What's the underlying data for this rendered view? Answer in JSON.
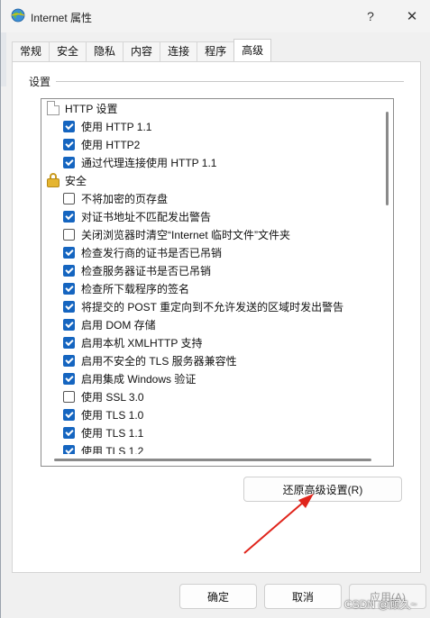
{
  "window": {
    "title": "Internet 属性",
    "help_label": "?",
    "close_label": "✕"
  },
  "tabs": [
    {
      "label": "常规"
    },
    {
      "label": "安全"
    },
    {
      "label": "隐私"
    },
    {
      "label": "内容"
    },
    {
      "label": "连接"
    },
    {
      "label": "程序"
    },
    {
      "label": "高级",
      "active": true
    }
  ],
  "settings": {
    "group_label": "设置",
    "items": [
      {
        "type": "category",
        "icon": "document-icon",
        "label": "HTTP 设置"
      },
      {
        "type": "option",
        "checked": true,
        "label": "使用 HTTP 1.1"
      },
      {
        "type": "option",
        "checked": true,
        "label": "使用 HTTP2"
      },
      {
        "type": "option",
        "checked": true,
        "label": "通过代理连接使用 HTTP 1.1"
      },
      {
        "type": "category",
        "icon": "lock-icon",
        "label": "安全"
      },
      {
        "type": "option",
        "checked": false,
        "label": "不将加密的页存盘"
      },
      {
        "type": "option",
        "checked": true,
        "label": "对证书地址不匹配发出警告"
      },
      {
        "type": "option",
        "checked": false,
        "label": "关闭浏览器时清空“Internet 临时文件”文件夹"
      },
      {
        "type": "option",
        "checked": true,
        "label": "检查发行商的证书是否已吊销"
      },
      {
        "type": "option",
        "checked": true,
        "label": "检查服务器证书是否已吊销"
      },
      {
        "type": "option",
        "checked": true,
        "label": "检查所下载程序的签名"
      },
      {
        "type": "option",
        "checked": true,
        "label": "将提交的 POST 重定向到不允许发送的区域时发出警告"
      },
      {
        "type": "option",
        "checked": true,
        "label": "启用 DOM 存储"
      },
      {
        "type": "option",
        "checked": true,
        "label": "启用本机 XMLHTTP 支持"
      },
      {
        "type": "option",
        "checked": true,
        "label": "启用不安全的 TLS 服务器兼容性"
      },
      {
        "type": "option",
        "checked": true,
        "label": "启用集成 Windows 验证"
      },
      {
        "type": "option",
        "checked": false,
        "label": "使用 SSL 3.0"
      },
      {
        "type": "option",
        "checked": true,
        "label": "使用 TLS 1.0"
      },
      {
        "type": "option",
        "checked": true,
        "label": "使用 TLS 1.1"
      },
      {
        "type": "option",
        "checked": true,
        "label": "使用 TLS 1.2"
      }
    ]
  },
  "buttons": {
    "restore": "还原高级设置(R)",
    "ok": "确定",
    "cancel": "取消",
    "apply": "应用(A)"
  },
  "watermark": "CSDN @顾久~",
  "colors": {
    "checkbox_checked": "#1565c0",
    "annotation_arrow": "#e0241b"
  }
}
